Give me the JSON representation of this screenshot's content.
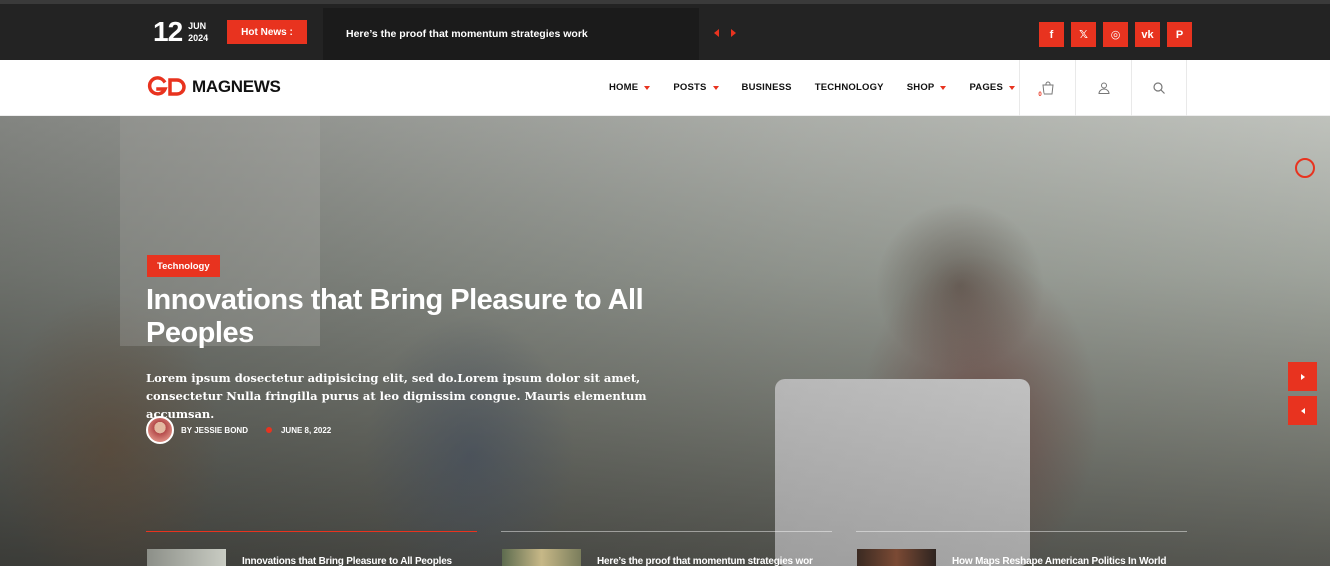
{
  "topbar": {
    "date": {
      "day": "12",
      "month": "JUN",
      "year": "2024"
    },
    "hot_label": "Hot News :",
    "ticker": "Here’s the proof that momentum strategies work",
    "socials": [
      {
        "icon": "facebook-icon",
        "glyph": "f"
      },
      {
        "icon": "x-icon",
        "glyph": "𝕏"
      },
      {
        "icon": "instagram-icon",
        "glyph": "◎"
      },
      {
        "icon": "vk-icon",
        "glyph": "vk"
      },
      {
        "icon": "pinterest-icon",
        "glyph": "P"
      }
    ]
  },
  "nav": {
    "logo_text": "MAGNEWS",
    "items": [
      {
        "label": "HOME",
        "dropdown": true
      },
      {
        "label": "POSTS",
        "dropdown": true
      },
      {
        "label": "BUSINESS",
        "dropdown": false
      },
      {
        "label": "TECHNOLOGY",
        "dropdown": false
      },
      {
        "label": "SHOP",
        "dropdown": true
      },
      {
        "label": "PAGES",
        "dropdown": true
      }
    ],
    "cart_count": "0"
  },
  "hero": {
    "category": "Technology",
    "title": "Innovations that Bring Pleasure to All Peoples",
    "excerpt": "Lorem ipsum dosectetur adipisicing elit, sed do.Lorem ipsum dolor sit amet, consectetur Nulla fringilla purus at leo dignissim congue. Mauris elementum accumsan.",
    "author": "BY JESSIE BOND",
    "date": "JUNE 8, 2022"
  },
  "thumbnails": [
    {
      "title": "Innovations that Bring Pleasure to All Peoples"
    },
    {
      "title": "Here’s the proof that momentum strategies wor"
    },
    {
      "title": "How Maps Reshape American Politics In World"
    }
  ],
  "colors": {
    "accent": "#e8331f",
    "topbar": "#232323"
  }
}
